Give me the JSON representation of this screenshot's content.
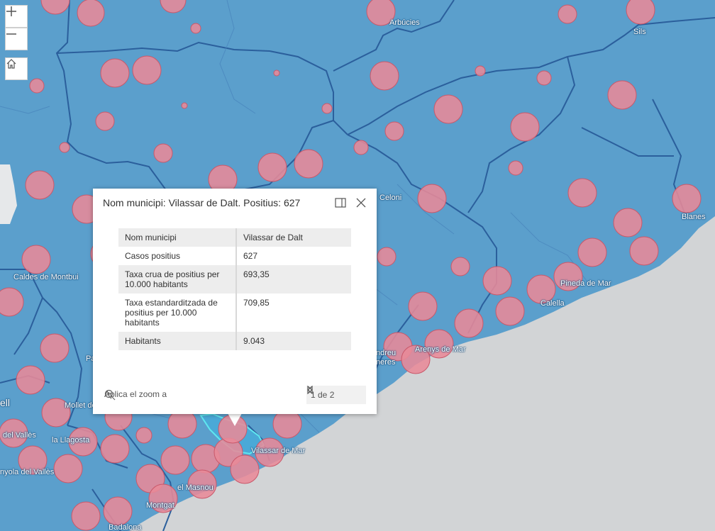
{
  "map_controls": {
    "zoom_in": "zoom-in",
    "zoom_out": "zoom-out",
    "home": "home"
  },
  "colors": {
    "land": "#5b9fcc",
    "sea": "#d2d4d6",
    "boundary": "#2b5f9c",
    "circle_fill": "#e88a98",
    "circle_stroke": "#c9586a",
    "selected": "#3db0e0"
  },
  "place_labels": [
    {
      "id": "arbucies",
      "text": "Arbúcies"
    },
    {
      "id": "sils",
      "text": "Sils"
    },
    {
      "id": "celoni",
      "text": "Celoni"
    },
    {
      "id": "blanes",
      "text": "Blanes"
    },
    {
      "id": "caldes",
      "text": "Caldes de Montbui"
    },
    {
      "id": "pineda",
      "text": "Pineda de Mar"
    },
    {
      "id": "calella",
      "text": "Calella"
    },
    {
      "id": "arenys",
      "text": "Arenys de Mar"
    },
    {
      "id": "andreu",
      "text": "ndreu"
    },
    {
      "id": "neres",
      "text": "neres"
    },
    {
      "id": "pa",
      "text": "Pa"
    },
    {
      "id": "mollet",
      "text": "Mollet de"
    },
    {
      "id": "ell",
      "text": "ell"
    },
    {
      "id": "valles",
      "text": "del Vallès"
    },
    {
      "id": "llagosta",
      "text": "la Llagosta"
    },
    {
      "id": "nyola",
      "text": "nyola del Vallès"
    },
    {
      "id": "vilassar_mar",
      "text": "Vilassar de Mar"
    },
    {
      "id": "masnou",
      "text": "el Masnou"
    },
    {
      "id": "montgat",
      "text": "Montgat"
    },
    {
      "id": "badalona",
      "text": "Badalona"
    }
  ],
  "popup": {
    "title": "Nom municipi: Vilassar de Dalt. Positius: 627",
    "dock_icon": "dock-icon",
    "close_icon": "close-icon",
    "attributes": [
      {
        "key": "Nom municipi",
        "value": "Vilassar de Dalt"
      },
      {
        "key": "Casos positius",
        "value": "627"
      },
      {
        "key": "Taxa crua de positius per 10.000 habitants",
        "value": "693,35"
      },
      {
        "key": "Taxa estandarditzada de positius per 10.000 habitants",
        "value": "709,85"
      },
      {
        "key": "Habitants",
        "value": "9.043"
      }
    ],
    "zoom_to_label": "Aplica el zoom a",
    "pager": {
      "current": "1",
      "total": "2",
      "text": "1 de 2"
    }
  }
}
